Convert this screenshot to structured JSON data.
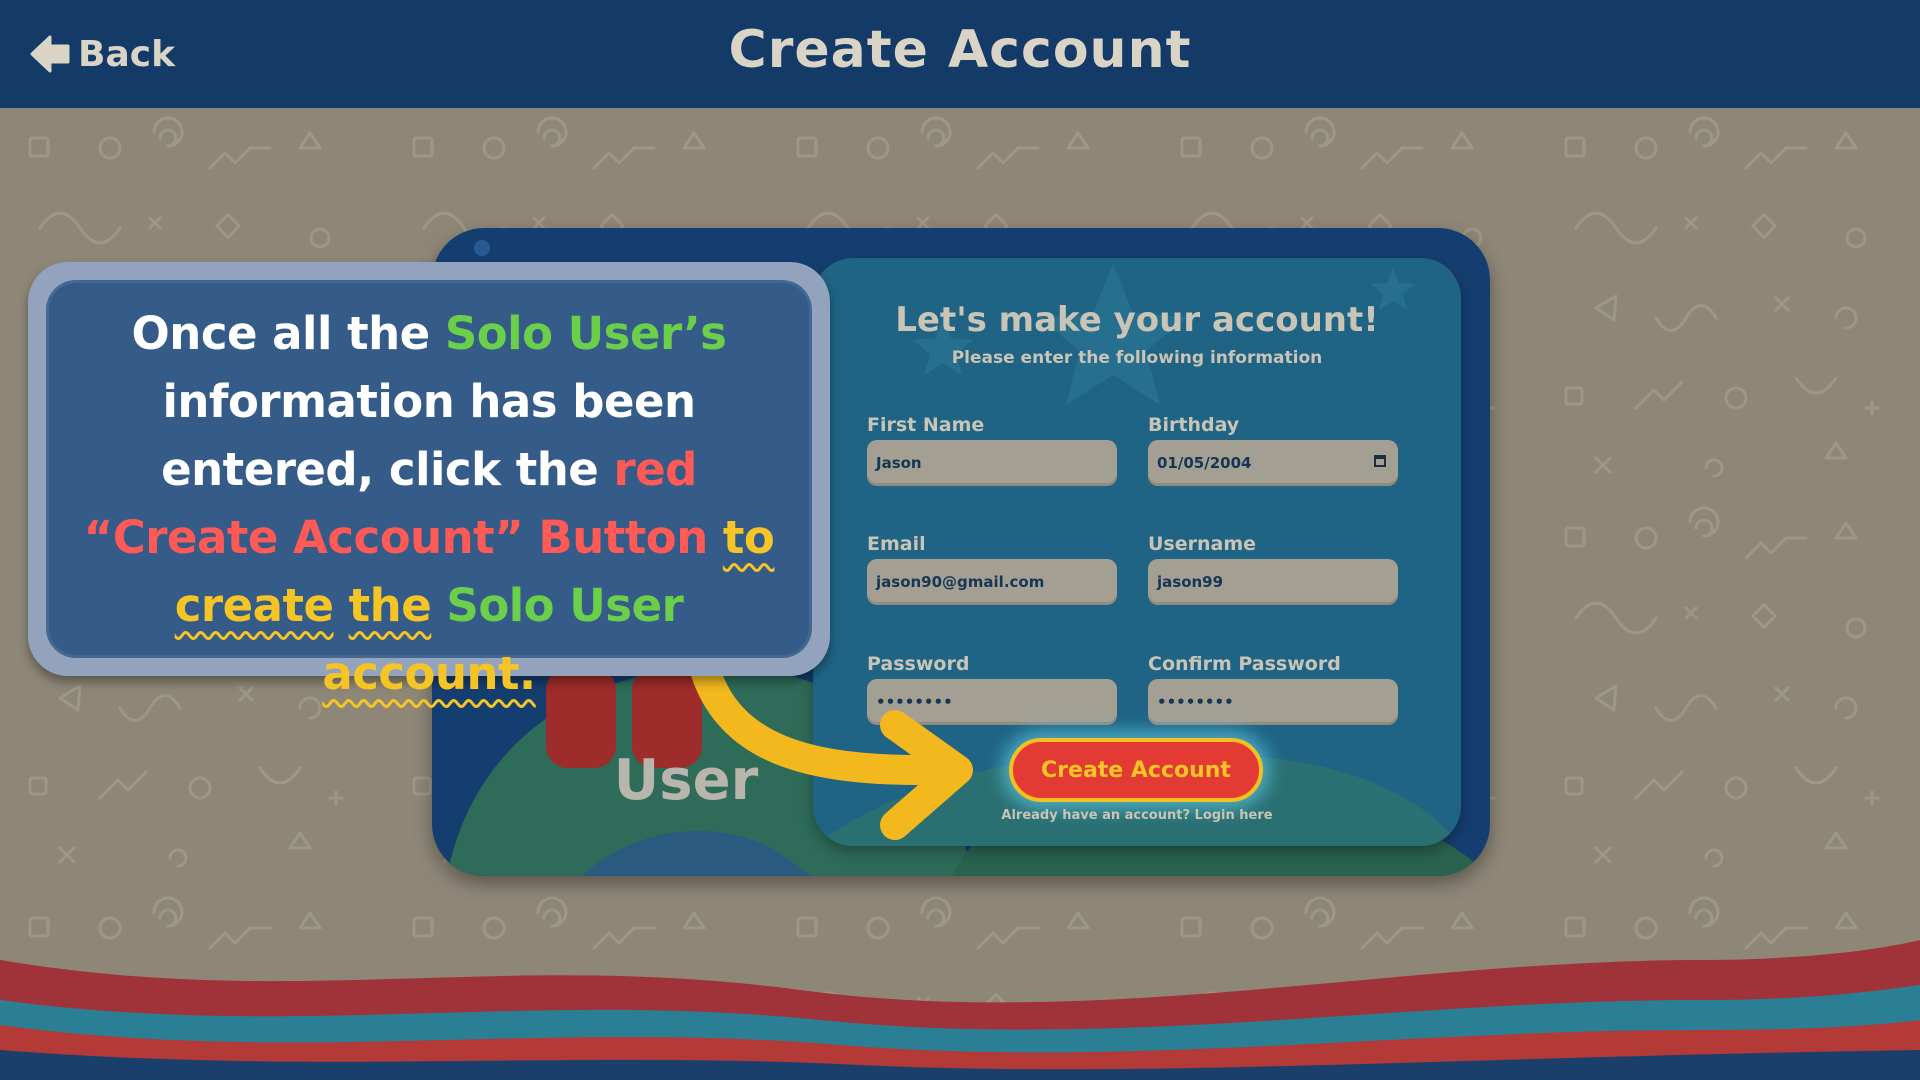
{
  "header": {
    "back_label": "Back",
    "title": "Create Account"
  },
  "card": {
    "side_label": "User"
  },
  "form": {
    "title": "Let's make your account!",
    "subtitle": "Please enter the following information",
    "fields": [
      {
        "label": "First Name",
        "value": "Jason"
      },
      {
        "label": "Birthday",
        "value": "01/05/2004"
      },
      {
        "label": "Email",
        "value": "jason90@gmail.com"
      },
      {
        "label": "Username",
        "value": "jason99"
      },
      {
        "label": "Password",
        "value": "••••••••"
      },
      {
        "label": "Confirm Password",
        "value": "••••••••"
      }
    ],
    "submit_label": "Create Account",
    "login_text": "Already have an account? Login here"
  },
  "callout": {
    "p1": "Once all the ",
    "p2": "Solo User’s",
    "p3": " information has been entered, click the ",
    "p4": "red “Create Account” Button",
    "p5": " ",
    "p6": "to create",
    "p7": " ",
    "p8": "the",
    "p9": " ",
    "p10": "Solo User",
    "p11": " ",
    "p12": "account."
  },
  "colors": {
    "header_bg": "#143a68",
    "background": "#8e8778",
    "panel": "#1f6484",
    "button_red": "#e33b33",
    "button_text": "#f5c526",
    "callout_bg": "#355c89",
    "highlight_green": "#6ccf4a",
    "highlight_red": "#ff5a55",
    "highlight_yellow": "#f5c526"
  },
  "icons": {
    "back": "arrow-left-icon",
    "birthday": "calendar-icon",
    "pointer": "curved-arrow-icon"
  }
}
